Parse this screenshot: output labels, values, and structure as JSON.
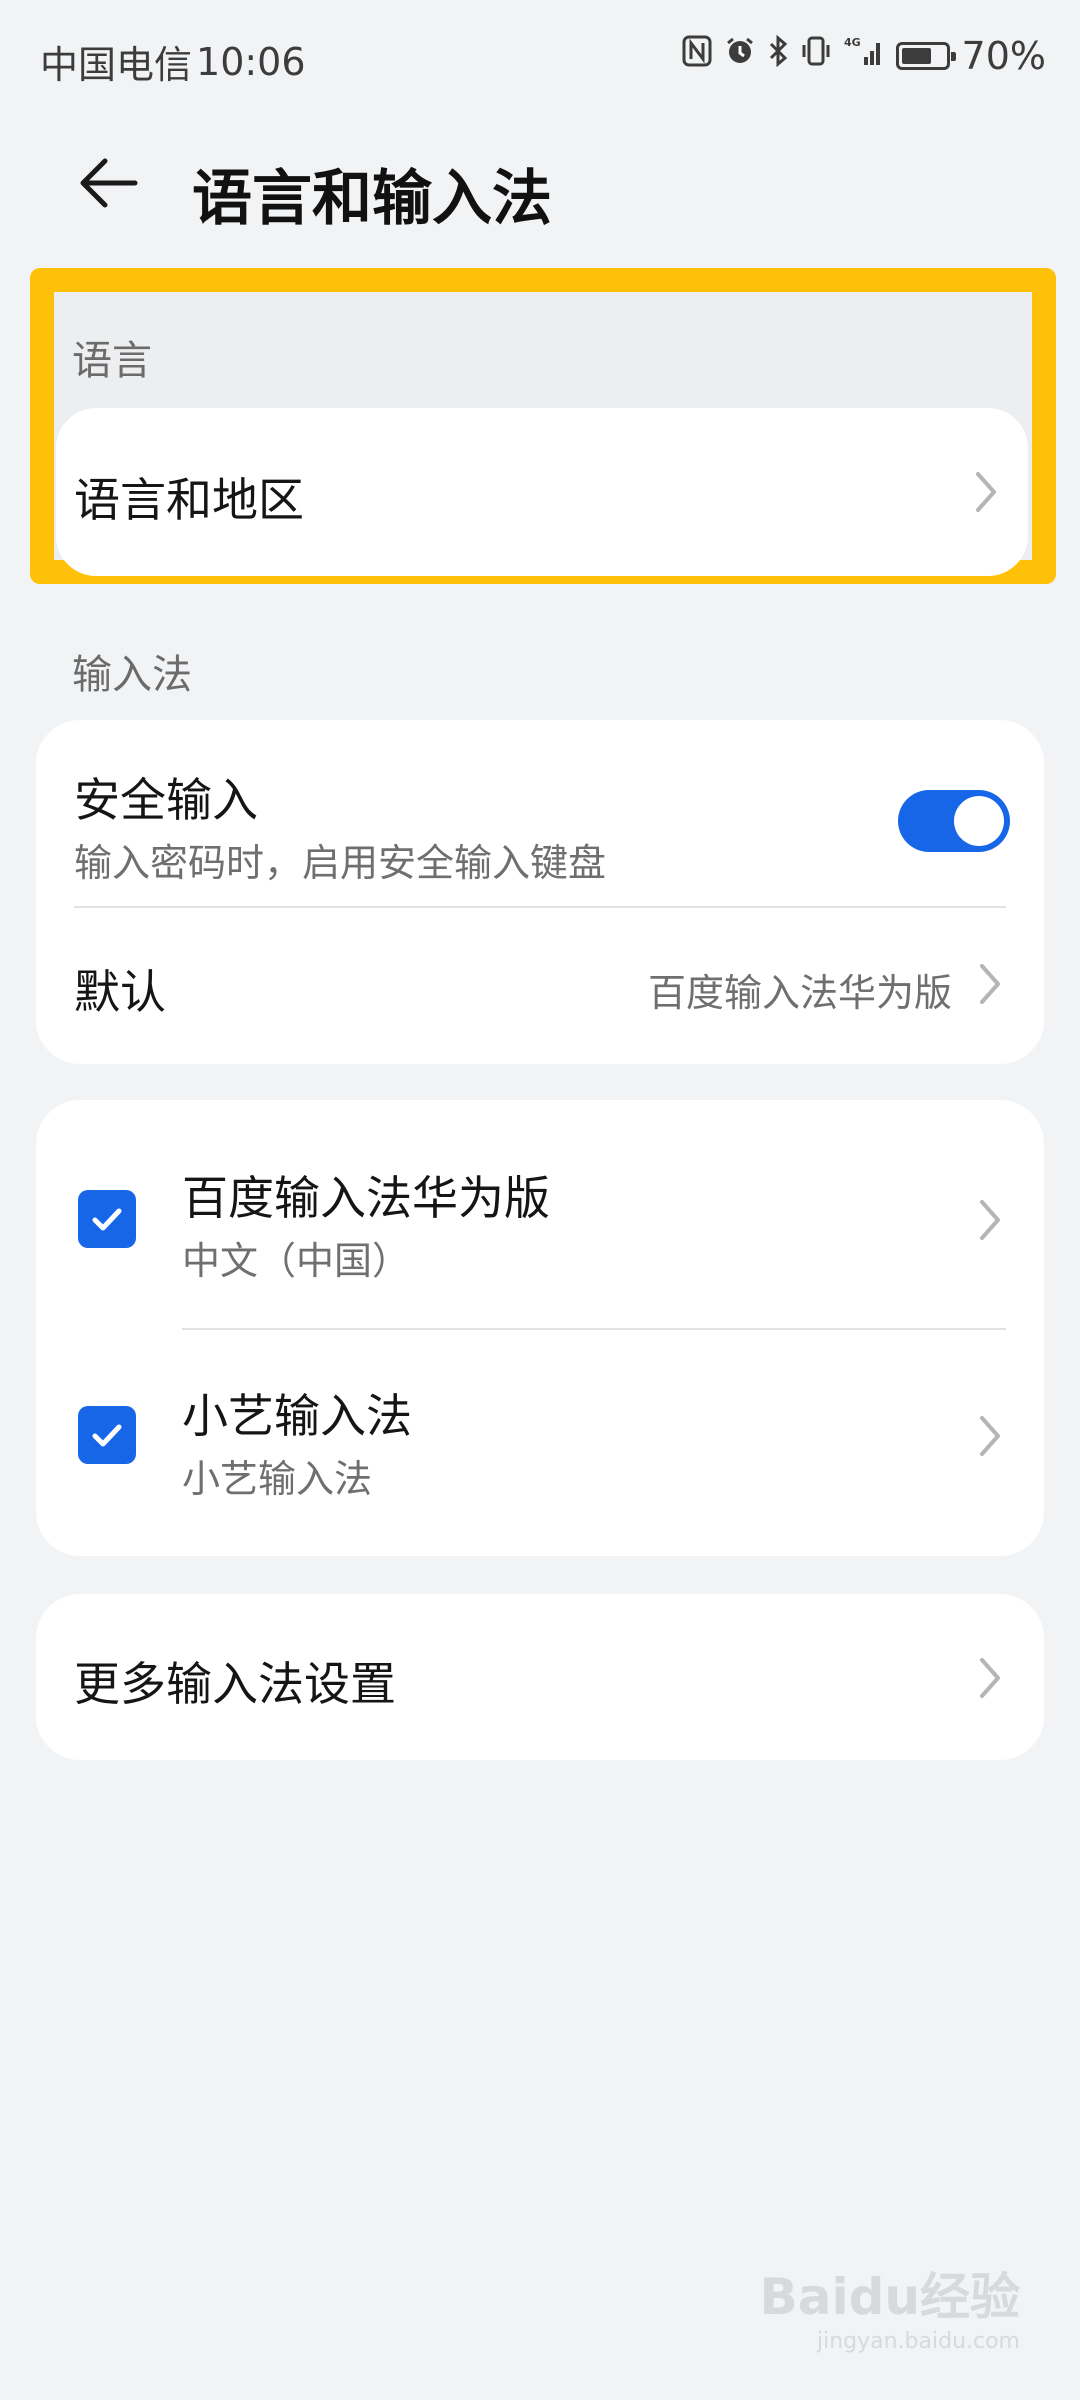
{
  "status_bar": {
    "carrier": "中国电信",
    "time": "10:06",
    "network": "4G",
    "battery": "70%",
    "battery_level": 0.7,
    "icons": [
      "nfc-icon",
      "alarm-icon",
      "bluetooth-icon",
      "vibrate-icon",
      "signal-icon",
      "battery-icon"
    ]
  },
  "header": {
    "title": "语言和输入法",
    "back_icon": "back-arrow-icon"
  },
  "language_section": {
    "label": "语言",
    "items": [
      {
        "title": "语言和地区"
      }
    ],
    "highlight_color": "#ffc107"
  },
  "input_section": {
    "label": "输入法",
    "secure_input": {
      "title": "安全输入",
      "subtitle": "输入密码时，启用安全输入键盘",
      "enabled": true
    },
    "default": {
      "title": "默认",
      "value": "百度输入法华为版"
    }
  },
  "keyboards": [
    {
      "title": "百度输入法华为版",
      "subtitle": "中文（中国）",
      "checked": true
    },
    {
      "title": "小艺输入法",
      "subtitle": "小艺输入法",
      "checked": true
    }
  ],
  "more_settings": {
    "title": "更多输入法设置"
  },
  "colors": {
    "accent": "#1766e8",
    "background": "#f1f3f5",
    "card": "#ffffff"
  },
  "watermark": {
    "brand": "Baidu经验",
    "url": "jingyan.baidu.com"
  }
}
